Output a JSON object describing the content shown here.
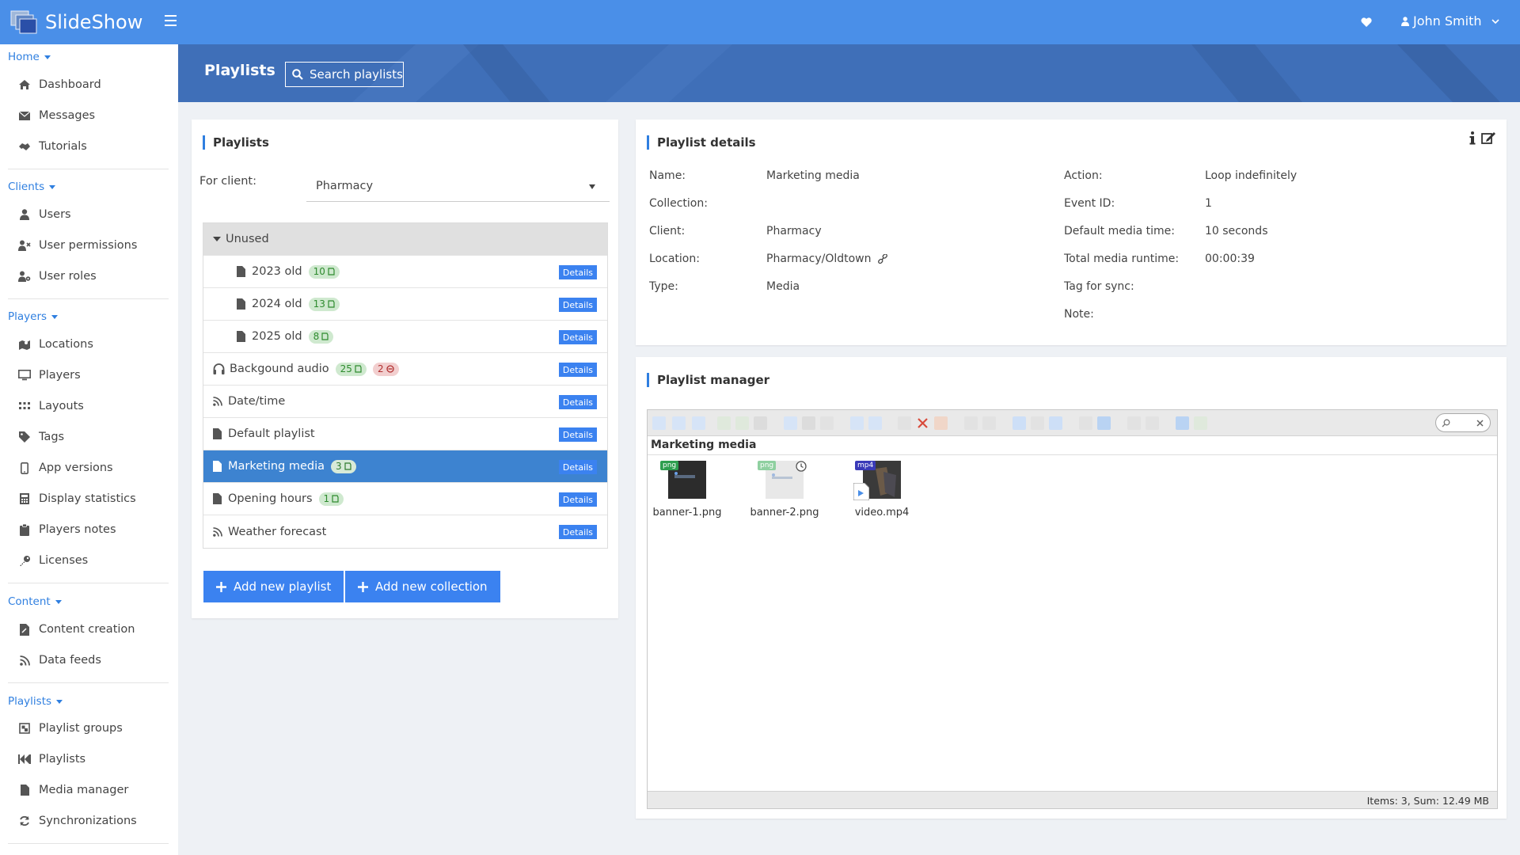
{
  "app": {
    "brand": "SlideShow",
    "user_name": "John Smith"
  },
  "sidebar": {
    "sections": [
      {
        "title": "Home",
        "items": [
          "Dashboard",
          "Messages",
          "Tutorials"
        ]
      },
      {
        "title": "Clients",
        "items": [
          "Users",
          "User permissions",
          "User roles"
        ]
      },
      {
        "title": "Players",
        "items": [
          "Locations",
          "Players",
          "Layouts",
          "Tags",
          "App versions",
          "Display statistics",
          "Players notes",
          "Licenses"
        ]
      },
      {
        "title": "Content",
        "items": [
          "Content creation",
          "Data feeds"
        ]
      },
      {
        "title": "Playlists",
        "items": [
          "Playlist groups",
          "Playlists",
          "Media manager",
          "Synchronizations"
        ]
      }
    ]
  },
  "header": {
    "title": "Playlists",
    "search_label": "Search playlists"
  },
  "playlists_card": {
    "title": "Playlists",
    "client_label": "For client:",
    "client_value": "Pharmacy",
    "group_label": "Unused",
    "details_label": "Details",
    "rows": [
      {
        "name": "2023 old",
        "badge": "10"
      },
      {
        "name": "2024 old",
        "badge": "13"
      },
      {
        "name": "2025 old",
        "badge": "8"
      },
      {
        "name": "Backgound audio",
        "badge": "25",
        "badge2": "2"
      },
      {
        "name": "Date/time"
      },
      {
        "name": "Default playlist"
      },
      {
        "name": "Marketing media",
        "badge": "3"
      },
      {
        "name": "Opening hours",
        "badge": "1"
      },
      {
        "name": "Weather forecast"
      }
    ],
    "add_playlist": "Add new playlist",
    "add_collection": "Add new collection"
  },
  "details_card": {
    "title": "Playlist details",
    "left": [
      {
        "label": "Name:",
        "value": "Marketing media"
      },
      {
        "label": "Collection:",
        "value": ""
      },
      {
        "label": "Client:",
        "value": "Pharmacy"
      },
      {
        "label": "Location:",
        "value": "Pharmacy/Oldtown"
      },
      {
        "label": "Type:",
        "value": "Media"
      }
    ],
    "right": [
      {
        "label": "Action:",
        "value": "Loop indefinitely"
      },
      {
        "label": "Event ID:",
        "value": "1"
      },
      {
        "label": "Default media time:",
        "value": "10 seconds"
      },
      {
        "label": "Total media runtime:",
        "value": "00:00:39"
      },
      {
        "label": "Tag for sync:",
        "value": ""
      },
      {
        "label": "Note:",
        "value": ""
      }
    ]
  },
  "manager_card": {
    "title": "Playlist manager",
    "path": "Marketing media",
    "files": [
      {
        "name": "banner-1.png",
        "type": "png"
      },
      {
        "name": "banner-2.png",
        "type": "png"
      },
      {
        "name": "video.mp4",
        "type": "mp4"
      }
    ],
    "status": "Items: 3, Sum: 12.49 MB",
    "colors": {
      "png_tag": "#2e9e4f",
      "png_tag_light": "#8fd0a0",
      "mp4_tag": "#3a3ab8"
    }
  }
}
